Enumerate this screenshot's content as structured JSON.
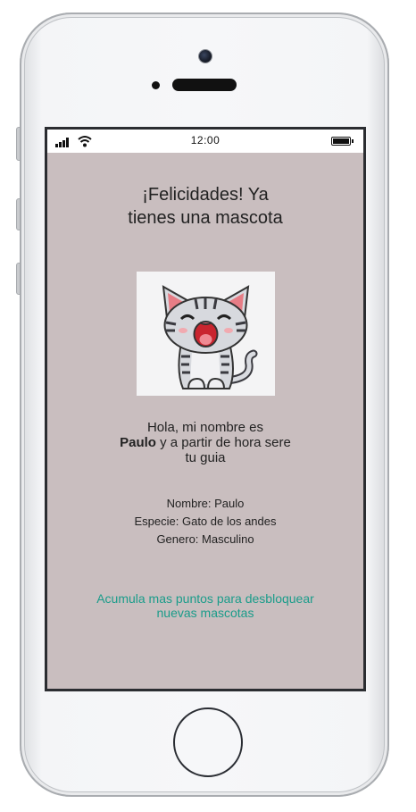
{
  "status_bar": {
    "time": "12:00"
  },
  "screen": {
    "title": "¡Felicidades! Ya tienes una mascota",
    "image": {
      "icon": "cartoon-cat-icon"
    },
    "intro": {
      "prefix": "Hola, mi nombre es",
      "pet_name": "Paulo",
      "suffix": "y a partir de hora sere tu guia"
    },
    "details": {
      "nombre": "Nombre: Paulo",
      "especie": "Especie: Gato de los andes",
      "genero": "Genero: Masculino"
    },
    "cta": "Acumula mas puntos para desbloquear nuevas mascotas"
  },
  "colors": {
    "screen_background": "#c9bebf",
    "cta_text": "#1a9c8a",
    "phone_body": "#f6f7f9"
  }
}
